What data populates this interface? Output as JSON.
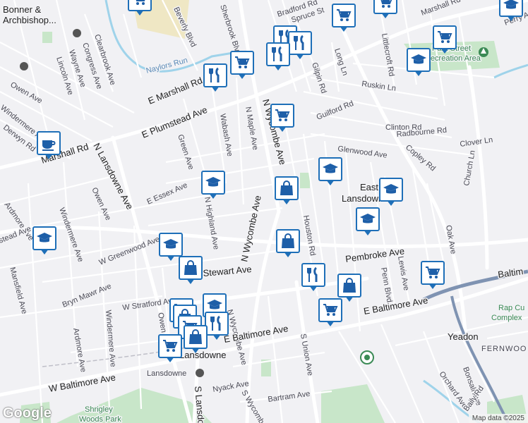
{
  "map": {
    "attribution": "Map data ©2025",
    "logo": "Google",
    "colors": {
      "background": "#f1f1f4",
      "road_major": "#ffffff",
      "road_highway": "#7f93b2",
      "park": "#c8e6c9",
      "campus": "#efe7c4",
      "pin_border": "#1e6fb8",
      "water": "#9fd3ea"
    },
    "labels": {
      "bonner": "Bonner &",
      "archbishop": "Archbishop...",
      "bradford_rd": "Bradford Rd",
      "spruce_st": "Spruce St",
      "marshall_rd_ne": "Marshall Rd",
      "perry_ave": "Perry Ave",
      "beverly_blvd": "Beverly Blvd",
      "sherbrook_blvd": "Sherbrook Blvd",
      "clearbrook_ave": "Clearbrook Ave",
      "congress_ave": "Congress Ave",
      "wayne_ave": "Wayne Ave",
      "lincoln_ave": "Lincoln Ave",
      "naylors_run": "Naylors Run",
      "littlecroft_rd": "Littlecroft Rd",
      "park_street": "Park Street",
      "recreation_area": "Recreation Area",
      "long_ln": "Long Ln",
      "gilpin_rd": "Gilpin Rd",
      "ruskin_ln": "Ruskin Ln",
      "owen_ave_nw": "Owen Ave",
      "windermere_ave_nw": "Windermere Ave",
      "derwyn_rd": "Derwyn Rd",
      "e_marshall_rd": "E Marshall Rd",
      "marshall_rd_w": "Marshall Rd",
      "e_plumstead_ave": "E Plumstead Ave",
      "n_maple_ave": "N Maple Ave",
      "n_wycombe_ave_n": "N Wycombe Ave",
      "guilford_rd": "Guilford Rd",
      "clinton_rd": "Clinton Rd",
      "radbourne_rd": "Radbourne Rd",
      "clover_ln": "Clover Ln",
      "copley_rd": "Copley Rd",
      "church_ln": "Church Ln",
      "glenwood_ave": "Glenwood Ave",
      "wabash_ave": "Wabash Ave",
      "green_ave": "Green Ave",
      "n_lansdowne_ave": "N Lansdowne Ave",
      "east_lansdowne_1": "East",
      "east_lansdowne_2": "Lansdowne",
      "e_essex_ave": "E Essex Ave",
      "owen_ave": "Owen Ave",
      "ardmore_ave_w": "Ardmore Ave",
      "stead_ave": "stead Ave",
      "windermere_ave": "Windermere Ave",
      "n_highland_ave": "N Highland Ave",
      "n_wycombe_ave": "N Wycombe Ave",
      "houston_rd": "Houston Rd",
      "oak_ave": "Oak Ave",
      "w_greenwood_ave": "W Greenwood Ave",
      "pembroke_ave": "Pembroke Ave",
      "mansfield_ave": "Mansfield Ave",
      "stewart_ave": "Stewart Ave",
      "bryn_mawr_ave": "Bryn Mawr Ave",
      "lewis_ave": "Lewis Ave",
      "penn_blvd": "Penn Blvd",
      "baltimore_e": "Baltim",
      "w_stratford_ave": "W Stratford Ave",
      "owen_ave_s": "Owen Ave",
      "windermere_ave_s": "Windermere Ave",
      "n_wycombe_ave_s": "N Wycombe Ave",
      "e_baltimore_ave_1": "E Baltimore Ave",
      "e_baltimore_ave_2": "E Baltimore Ave",
      "rap_curtis_1": "Rap Cu",
      "rap_curtis_2": "Complex",
      "yeadon": "Yeadon",
      "fernwood": "FERNWOO",
      "ardmore_ave_s": "Ardmore Ave",
      "lansdowne_town": "Lansdowne",
      "lansdowne_station": "Lansdowne",
      "w_baltimore_ave": "W Baltimore Ave",
      "s_union_ave": "S Union Ave",
      "nyack_ave": "Nyack Ave",
      "bartram_ave": "Bartram Ave",
      "s_lansdowne": "S Lansdo",
      "s_wycombe": "S Wycombe",
      "orchard_ave": "Orchard Ave",
      "bonsall_ave": "Bonsall Ave",
      "baily_rd": "Baily Rd",
      "shrigley_1": "Shrigley",
      "shrigley_2": "Woods Park"
    },
    "pins": [
      {
        "type": "grocery",
        "icon": "shopping-cart-icon"
      },
      {
        "type": "grocery",
        "icon": "shopping-cart-icon"
      },
      {
        "type": "grocery",
        "icon": "shopping-cart-icon"
      },
      {
        "type": "education",
        "icon": "graduation-cap-icon"
      },
      {
        "type": "restaurant",
        "icon": "fork-knife-icon"
      },
      {
        "type": "restaurant",
        "icon": "fork-knife-icon"
      },
      {
        "type": "restaurant",
        "icon": "fork-knife-icon"
      },
      {
        "type": "restaurant",
        "icon": "fork-knife-icon"
      },
      {
        "type": "grocery",
        "icon": "shopping-cart-icon"
      },
      {
        "type": "grocery",
        "icon": "shopping-cart-icon"
      },
      {
        "type": "cafe",
        "icon": "coffee-cup-icon"
      },
      {
        "type": "education",
        "icon": "graduation-cap-icon"
      },
      {
        "type": "shopping",
        "icon": "shopping-bag-icon"
      },
      {
        "type": "education",
        "icon": "graduation-cap-icon"
      },
      {
        "type": "education",
        "icon": "graduation-cap-icon"
      },
      {
        "type": "education",
        "icon": "graduation-cap-icon"
      },
      {
        "type": "shopping",
        "icon": "shopping-bag-icon"
      },
      {
        "type": "education",
        "icon": "graduation-cap-icon"
      },
      {
        "type": "education",
        "icon": "graduation-cap-icon"
      },
      {
        "type": "shopping",
        "icon": "shopping-bag-icon"
      },
      {
        "type": "restaurant",
        "icon": "fork-knife-icon"
      },
      {
        "type": "shopping",
        "icon": "shopping-bag-icon"
      },
      {
        "type": "grocery",
        "icon": "shopping-cart-icon"
      },
      {
        "type": "grocery",
        "icon": "shopping-cart-icon"
      },
      {
        "type": "education",
        "icon": "graduation-cap-icon"
      },
      {
        "type": "shopping",
        "icon": "shopping-bag-icon"
      },
      {
        "type": "restaurant",
        "icon": "fork-knife-icon"
      },
      {
        "type": "shopping",
        "icon": "shopping-bag-icon"
      },
      {
        "type": "grocery",
        "icon": "shopping-cart-icon"
      }
    ]
  }
}
